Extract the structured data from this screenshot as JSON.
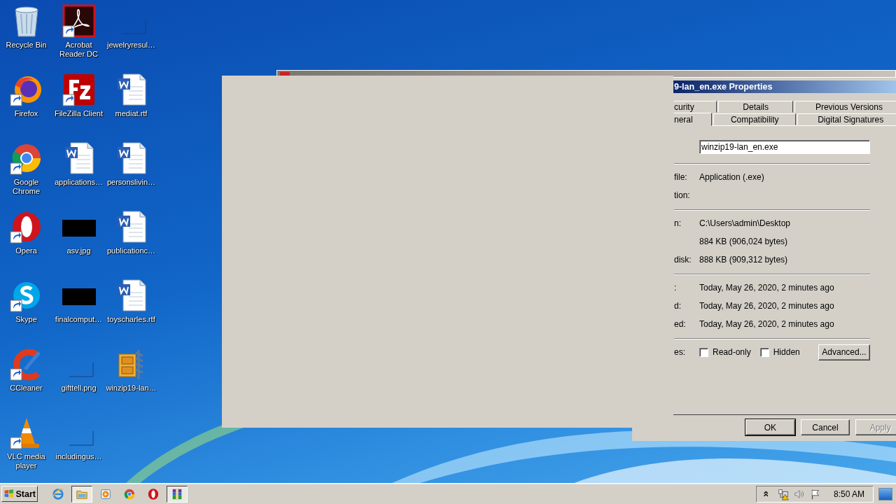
{
  "desktop": {
    "icons": [
      {
        "label": "Recycle Bin",
        "kind": "recycle",
        "shortcut": false
      },
      {
        "label": "Firefox",
        "kind": "firefox",
        "shortcut": true
      },
      {
        "label": "Google Chrome",
        "kind": "chrome",
        "shortcut": true
      },
      {
        "label": "Opera",
        "kind": "opera",
        "shortcut": true
      },
      {
        "label": "Skype",
        "kind": "skype",
        "shortcut": true
      },
      {
        "label": "CCleaner",
        "kind": "ccleaner",
        "shortcut": true
      },
      {
        "label": "VLC media player",
        "kind": "vlc",
        "shortcut": true
      },
      {
        "label": "Acrobat Reader DC",
        "kind": "acrobat",
        "shortcut": true
      },
      {
        "label": "FileZilla Client",
        "kind": "filezilla",
        "shortcut": true
      },
      {
        "label": "applications…",
        "kind": "word",
        "shortcut": false
      },
      {
        "label": "asv.jpg",
        "kind": "thumb",
        "shortcut": false
      },
      {
        "label": "finalcomput…",
        "kind": "thumb",
        "shortcut": false
      },
      {
        "label": "gifttell.png",
        "kind": "blank",
        "shortcut": false
      },
      {
        "label": "includingus…",
        "kind": "blank",
        "shortcut": false
      },
      {
        "label": "jewelryresul…",
        "kind": "blank",
        "shortcut": false
      },
      {
        "label": "mediat.rtf",
        "kind": "word",
        "shortcut": false
      },
      {
        "label": "personslivin…",
        "kind": "word",
        "shortcut": false
      },
      {
        "label": "publicationc…",
        "kind": "word",
        "shortcut": false
      },
      {
        "label": "toyscharles.rtf",
        "kind": "word",
        "shortcut": false
      },
      {
        "label": "winzip19-lan…",
        "kind": "winzip",
        "shortcut": false
      }
    ]
  },
  "properties_dialog": {
    "title": "9-lan_en.exe Properties",
    "tab_rows": [
      [
        {
          "label": "curity",
          "selected": false
        },
        {
          "label": "Details",
          "selected": false
        },
        {
          "label": "Previous Versions",
          "selected": false
        }
      ],
      [
        {
          "label": "neral",
          "selected": true
        },
        {
          "label": "Compatibility",
          "selected": false
        },
        {
          "label": "Digital Signatures",
          "selected": false
        }
      ]
    ],
    "file_name": {
      "value": "winzip19-lan_en.exe"
    },
    "groups": [
      [
        {
          "label": "file:",
          "value": "Application (.exe)"
        },
        {
          "label": "tion:"
        }
      ],
      [
        {
          "label": "n:",
          "value": "C:\\Users\\admin\\Desktop"
        },
        {
          "value": "884 KB (906,024 bytes)"
        },
        {
          "label": "disk:",
          "value": "888 KB (909,312 bytes)"
        }
      ],
      [
        {
          "label": ":",
          "value": "Today, May 26, 2020, 2 minutes ago"
        },
        {
          "label": "d:",
          "value": "Today, May 26, 2020, 2 minutes ago"
        },
        {
          "label": "ed:",
          "value": "Today, May 26, 2020, 2 minutes ago"
        }
      ]
    ],
    "attributes": {
      "label": "es:",
      "checkboxes": [
        {
          "label": "Read-only",
          "checked": false
        },
        {
          "label": "Hidden",
          "checked": false
        }
      ],
      "advanced_button": "Advanced..."
    },
    "buttons": [
      {
        "label": "OK",
        "default": true,
        "disabled": false
      },
      {
        "label": "Cancel",
        "default": false,
        "disabled": false
      },
      {
        "label": "Apply",
        "default": false,
        "disabled": true
      }
    ]
  },
  "taskbar": {
    "start": "Start",
    "apps": [
      {
        "kind": "ie",
        "active": false
      },
      {
        "kind": "explorer",
        "active": true
      },
      {
        "kind": "media",
        "active": false
      },
      {
        "kind": "chrome",
        "active": false
      },
      {
        "kind": "opera",
        "active": false
      },
      {
        "kind": "winrar",
        "active": true
      }
    ],
    "tray_icons": [
      {
        "kind": "chevron"
      },
      {
        "kind": "network-warning"
      },
      {
        "kind": "volume"
      },
      {
        "kind": "flag"
      }
    ],
    "clock": "8:50 AM"
  }
}
